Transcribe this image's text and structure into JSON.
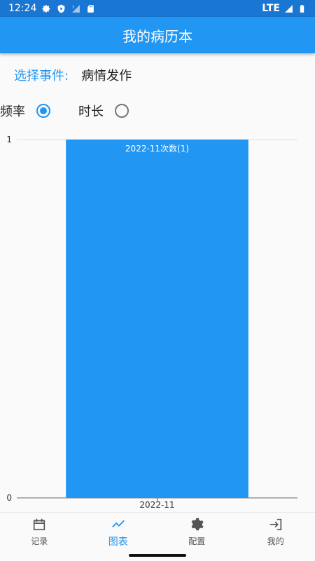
{
  "status_bar": {
    "time": "12:24",
    "network": "LTE",
    "icons": [
      "gear-icon",
      "shield-play-icon",
      "signal-question-icon",
      "sd-card-icon",
      "signal-icon",
      "battery-icon"
    ]
  },
  "app_bar": {
    "title": "我的病历本"
  },
  "event_selector": {
    "label": "选择事件:",
    "value": "病情发作"
  },
  "mode": {
    "options": [
      {
        "label": "频率",
        "checked": true
      },
      {
        "label": "时长",
        "checked": false
      }
    ]
  },
  "chart_data": {
    "type": "bar",
    "categories": [
      "2022-11"
    ],
    "values": [
      1
    ],
    "data_labels": [
      "2022-11次数(1)"
    ],
    "ylim": [
      0,
      1
    ],
    "yticks": [
      "0",
      "1"
    ],
    "color": "#2196f3",
    "grid": true
  },
  "bottom_nav": {
    "items": [
      {
        "label": "记录",
        "icon": "calendar-icon",
        "active": false
      },
      {
        "label": "图表",
        "icon": "trend-icon",
        "active": true
      },
      {
        "label": "配置",
        "icon": "gear-icon",
        "active": false
      },
      {
        "label": "我的",
        "icon": "login-icon",
        "active": false
      }
    ]
  },
  "colors": {
    "primary": "#2196f3",
    "status_bar": "#1976d2"
  }
}
